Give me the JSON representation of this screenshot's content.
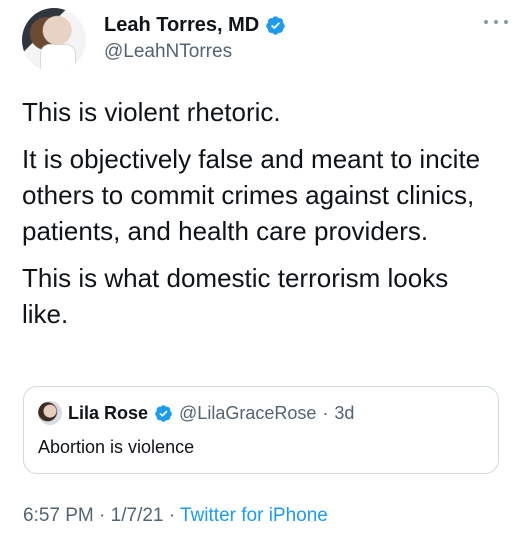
{
  "author": {
    "display_name": "Leah Torres, MD",
    "handle": "@LeahNTorres",
    "verified": true
  },
  "tweet": {
    "paragraphs": [
      [
        "This is violent rhetoric."
      ],
      [
        "It is objectively false and meant to incite",
        "others to commit crimes against clinics,",
        "patients, and health care providers."
      ],
      [
        "This is what domestic terrorism looks",
        "like."
      ]
    ]
  },
  "quoted_tweet": {
    "display_name": "Lila Rose",
    "handle": "@LilaGraceRose",
    "separator": "·",
    "time": "3d",
    "text": "Abortion is violence",
    "verified": true
  },
  "meta": {
    "time": "6:57 PM",
    "separator": "·",
    "date": "1/7/21",
    "source": "Twitter for iPhone"
  },
  "colors": {
    "verified": "#1d9bf0",
    "link": "#1d9bf0",
    "secondary_text": "#536471"
  },
  "icons": {
    "verified": "verified-badge-icon",
    "more": "more-horizontal-icon"
  }
}
